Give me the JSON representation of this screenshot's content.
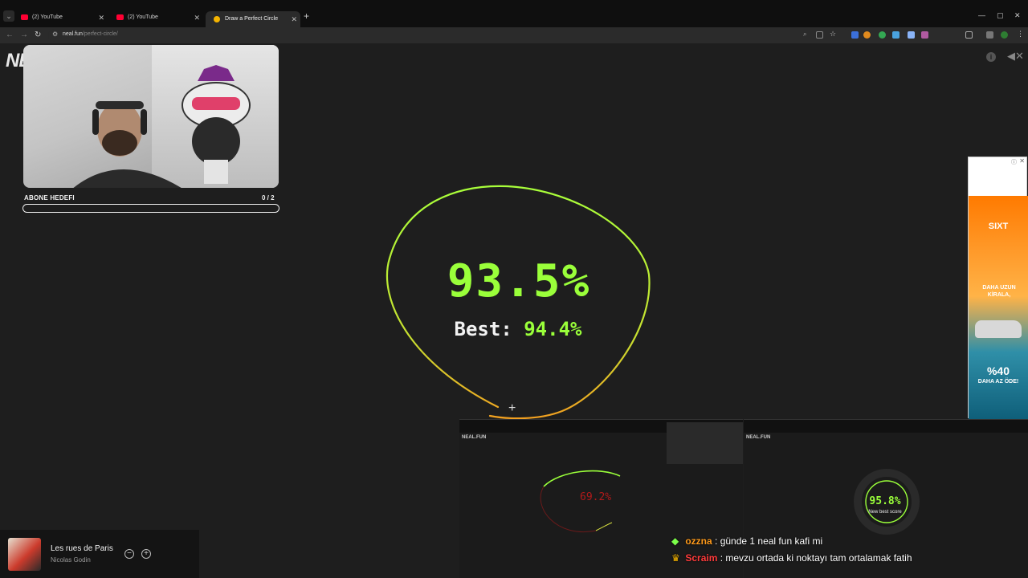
{
  "browser": {
    "tabs": [
      {
        "label": "(2) YouTube"
      },
      {
        "label": "(2) YouTube"
      },
      {
        "label": "Draw a Perfect Circle"
      }
    ],
    "url_host": "neal.fun",
    "url_path": "/perfect-circle/"
  },
  "page": {
    "logo": "NE",
    "score": "93.5%",
    "best_label": "Best:",
    "best_value": "94.4%"
  },
  "stream": {
    "goal_label": "ABONE HEDEFI",
    "goal_count": "0 / 2",
    "goal_progress": 0
  },
  "ad": {
    "brand": "SIXT",
    "tagline": "DAHA UZUN KİRALA,",
    "discount": "%40",
    "discount_sub": "DAHA AZ ÖDE!"
  },
  "overlay": {
    "mini1_logo": "NEAL.FUN",
    "mini1_score": "69.2%",
    "mini2_logo": "NEAL.FUN",
    "mini2_score": "95.8%",
    "mini2_sub": "New best score"
  },
  "chat": [
    {
      "user": "ozzna",
      "message": ": günde 1 neal fun kafi mi"
    },
    {
      "user": "Scraim",
      "message": ": mevzu ortada ki noktayı tam ortalamak fatih"
    }
  ],
  "music": {
    "title": "Les rues de Paris",
    "artist": "Nicolas Godin"
  },
  "colors": {
    "score_green": "#9aff3a",
    "background": "#1e1e1e",
    "accent_red": "#b01a1a"
  }
}
